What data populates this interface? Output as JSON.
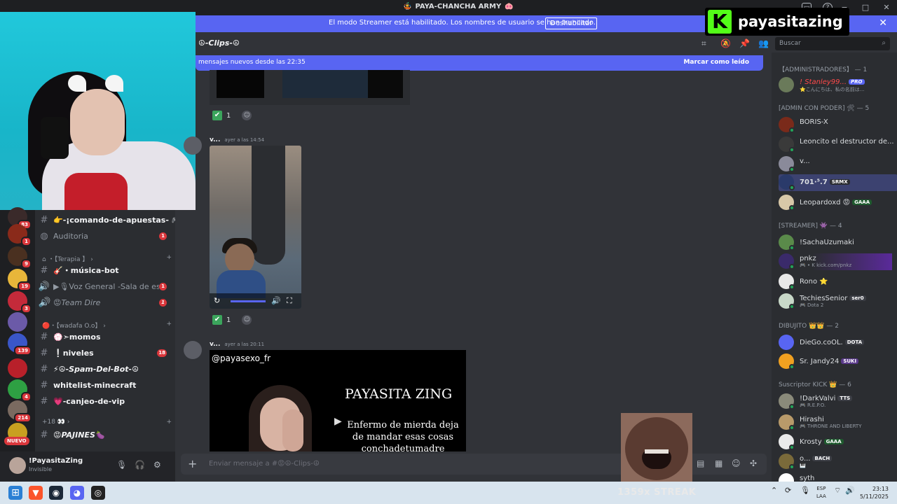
{
  "window": {
    "title": "PAYA-CHANCHA ARMY",
    "controls": [
      "−",
      "□",
      "✕"
    ]
  },
  "banner": {
    "message": "El modo Streamer está habilitado. Los nombres de usuario se han truncado.",
    "button": "Deshabilitar",
    "close": "✕"
  },
  "kick_overlay": {
    "logo": "K",
    "name": "payasitazing"
  },
  "channel": {
    "title": "☮-Clips-☮",
    "new_messages": "mensajes nuevos desde las 22:35",
    "mark_read": "Marcar como leído"
  },
  "search": {
    "placeholder": "Buscar"
  },
  "servers": [
    {
      "badge": "83",
      "color": "#3a2a2a"
    },
    {
      "badge": "1",
      "color": "#8a2a1a"
    },
    {
      "badge": "9",
      "color": "#4a3020"
    },
    {
      "badge": "19",
      "color": "#e8b63a"
    },
    {
      "badge": "3",
      "color": "#c42a3a"
    },
    {
      "badge": "",
      "color": "#6b5aa8"
    },
    {
      "badge": "139",
      "color": "#3a56c8"
    },
    {
      "badge": "",
      "color": "#b8202a"
    },
    {
      "badge": "4",
      "color": "#2ea043"
    },
    {
      "badge": "214",
      "color": "#7a6a60"
    },
    {
      "badge": "",
      "color": "#c8a020"
    }
  ],
  "nuevo_label": "NUEVO",
  "sidebar": {
    "channels": [
      {
        "name": "👉-¡comando-de-apuestas- 🎮 ...",
        "count": ""
      },
      {
        "name": "Auditoria",
        "count": "1"
      },
      {
        "name": "🎸・música-bot",
        "count": ""
      },
      {
        "name": "▶🎙Voz General -Sala de es...",
        "count": "1"
      },
      {
        "name": "😡Team Dire",
        "count": "1"
      },
      {
        "name": "💮➣momos",
        "count": ""
      },
      {
        "name": "❕niveles",
        "count": "18"
      },
      {
        "name": "⚡☮-Spam-Del-Bot-☮",
        "count": ""
      },
      {
        "name": "whitelist-minecraft",
        "count": ""
      },
      {
        "name": "💗-canjeo-de-vip",
        "count": ""
      },
      {
        "name": "😡PAJINES🍆",
        "count": ""
      }
    ],
    "categories": [
      "⌂ ・【Terapia 】 ›",
      "🔴・【wadafa O.o】 ›",
      "+18 👀 ›"
    ]
  },
  "user": {
    "name": "!PayasitaZing",
    "status": "Invisible"
  },
  "messages": [
    {
      "author": "v...",
      "time": "ayer a las 14:54"
    },
    {
      "author": "v...",
      "time": "ayer a las 20:11"
    }
  ],
  "reactions": [
    {
      "count": "1"
    },
    {
      "count": "1"
    }
  ],
  "embed": {
    "handle": "@payasexo_fr",
    "title": "PAYASITA ZING",
    "text": "Enfermo de mierda deja de mandar esas cosas conchadetumadre"
  },
  "composer": {
    "placeholder": "Enviar mensaje a #😡☮-Clips-☮"
  },
  "members": {
    "groups": [
      "【ADMINISTRADORES】 — 1",
      "[ADMIN CON PODER] 🛠 — 5",
      "[STREAMER] 👾 — 4",
      "DIBUJITO 👑👑 — 2",
      "Suscriptor KICK 👑 — 6"
    ],
    "list": [
      {
        "name": "! Stanley99...",
        "sub": "⭐こんにちは、私の名前は...",
        "tag": "PRO",
        "color": "#ff4a4a",
        "avatar": "#6a7a5a"
      },
      {
        "name": "BORIS-X",
        "sub": "",
        "tag": "",
        "color": "#dbdee1",
        "avatar": "#7a2a1a"
      },
      {
        "name": "Leoncito el destructor de...",
        "sub": "",
        "tag": "",
        "color": "#dbdee1",
        "avatar": "#3a3a3a"
      },
      {
        "name": "v...",
        "sub": "",
        "tag": "",
        "color": "#dbdee1",
        "avatar": "#8a8a9a"
      },
      {
        "name": "701·⁵.7",
        "sub": "",
        "tag": "SRMX",
        "color": "#f2f3f5",
        "avatar": "#2a3a6a"
      },
      {
        "name": "Leopardoxd 😡",
        "sub": "",
        "tag": "GAAA",
        "color": "#dbdee1",
        "avatar": "#d8c8a8"
      },
      {
        "name": "!SachaUzumaki",
        "sub": "",
        "tag": "",
        "color": "#dbdee1",
        "avatar": "#5a8a4a"
      },
      {
        "name": "pnkz",
        "sub": "🎮 • K kick.com/pnkz",
        "tag": "",
        "color": "#dbdee1",
        "avatar": "#3a2a6a"
      },
      {
        "name": "Rono ⭐",
        "sub": "",
        "tag": "",
        "color": "#dbdee1",
        "avatar": "#e8e8e8"
      },
      {
        "name": "TechiesSenior",
        "sub": "🎮 Dota 2",
        "tag": "ser0",
        "color": "#dbdee1",
        "avatar": "#c8d8c8"
      },
      {
        "name": "DieGo.coOL.",
        "sub": "",
        "tag": "DOTA",
        "color": "#dbdee1",
        "avatar": "#5865f2"
      },
      {
        "name": "Sr. Jandy24",
        "sub": "",
        "tag": "SUKI",
        "color": "#dbdee1",
        "avatar": "#f0a020"
      },
      {
        "name": "!DarkValvi",
        "sub": "🎮 R.E.P.O.",
        "tag": "TTS",
        "color": "#dbdee1",
        "avatar": "#8a8a7a"
      },
      {
        "name": "Hirashi",
        "sub": "🎮 THRONE AND LIBERTY",
        "tag": "",
        "color": "#dbdee1",
        "avatar": "#b89a6a"
      },
      {
        "name": "Krosty",
        "sub": "",
        "tag": "GAAA",
        "color": "#dbdee1",
        "avatar": "#eaeaea"
      },
      {
        "name": "o...",
        "sub": "🎹",
        "tag": "BACH",
        "color": "#dbdee1",
        "avatar": "#7a6a3a"
      },
      {
        "name": "syth",
        "sub": "",
        "tag": "",
        "color": "#dbdee1",
        "avatar": "#ffffff"
      }
    ]
  },
  "overlay": {
    "streak": "1359x STREAK"
  },
  "taskbar": {
    "lang1": "ESP",
    "lang2": "LAA",
    "time": "23:13",
    "date": "5/11/2025"
  }
}
